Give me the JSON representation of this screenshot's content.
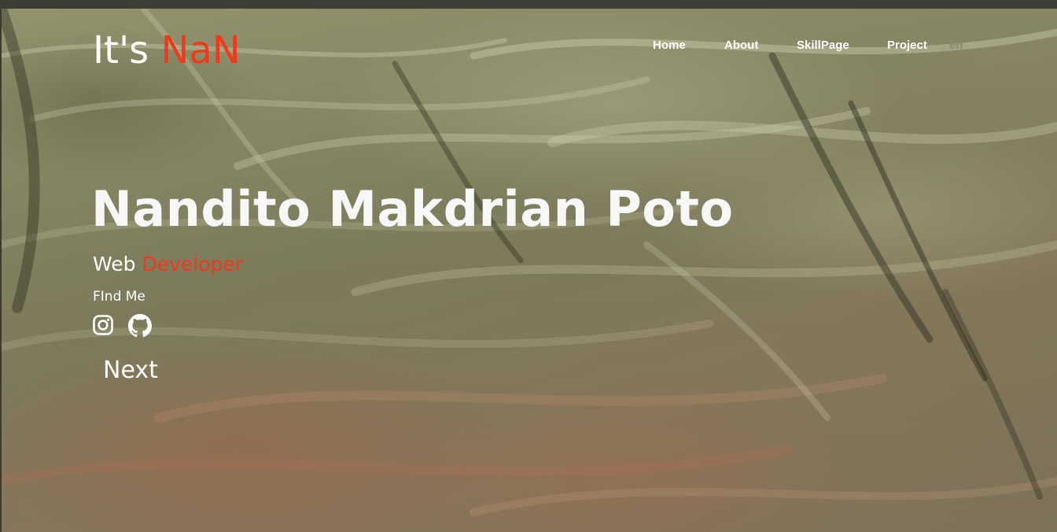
{
  "header": {
    "logo_prefix": "It's ",
    "logo_accent": "NaN"
  },
  "nav": {
    "items": [
      {
        "label": "Home"
      },
      {
        "label": "About"
      },
      {
        "label": "SkillPage"
      },
      {
        "label": "Project"
      }
    ],
    "language": "en"
  },
  "hero": {
    "name": "Nandito Makdrian Poto",
    "role_prefix": "Web ",
    "role_accent": "Developer",
    "find_me_label": "FInd Me",
    "socials": [
      {
        "icon": "instagram-icon"
      },
      {
        "icon": "github-icon"
      }
    ],
    "next_label": "Next"
  },
  "colors": {
    "accent": "#f0381a",
    "text": "#ffffff",
    "language_muted": "#8a8a72",
    "top_strip": "#3c3d33"
  }
}
